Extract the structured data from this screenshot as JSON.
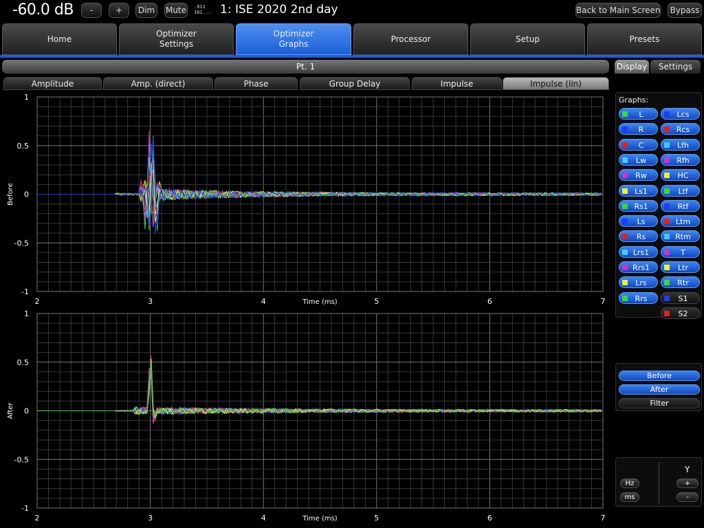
{
  "topbar": {
    "volume": "-60.0 dB",
    "minus_label": "-",
    "plus_label": "+",
    "dim_label": "Dim",
    "mute_label": "Mute",
    "tiny_line1": ".011",
    "tiny_line2": "101...",
    "preset_title": "1: ISE 2020 2nd day",
    "back_label": "Back to Main Screen",
    "bypass_label": "Bypass"
  },
  "main_tabs": [
    {
      "label": "Home",
      "active": false
    },
    {
      "label": "Optimizer\nSettings",
      "active": false
    },
    {
      "label": "Optimizer\nGraphs",
      "active": true
    },
    {
      "label": "Processor",
      "active": false
    },
    {
      "label": "Setup",
      "active": false
    },
    {
      "label": "Presets",
      "active": false
    }
  ],
  "point_header": "Pt. 1",
  "graph_tabs": [
    {
      "label": "Amplitude",
      "active": false
    },
    {
      "label": "Amp. (direct)",
      "active": false
    },
    {
      "label": "Phase",
      "active": false
    },
    {
      "label": "Group Delay",
      "active": false
    },
    {
      "label": "Impulse",
      "active": false
    },
    {
      "label": "Impulse (lin)",
      "active": true
    }
  ],
  "side_tabs": {
    "display": "Display",
    "settings": "Settings"
  },
  "graphs_label": "Graphs:",
  "channels_left": [
    {
      "label": "L",
      "color": "#33dd33",
      "active": true
    },
    {
      "label": "R",
      "color": "#1a3fff",
      "active": true
    },
    {
      "label": "C",
      "color": "#dd2222",
      "active": true
    },
    {
      "label": "Lw",
      "color": "#44ccff",
      "active": true
    },
    {
      "label": "Rw",
      "color": "#cc33cc",
      "active": true
    },
    {
      "label": "Ls1",
      "color": "#eeee33",
      "active": true
    },
    {
      "label": "Rs1",
      "color": "#33dd33",
      "active": true
    },
    {
      "label": "Ls",
      "color": "#1a3fff",
      "active": true
    },
    {
      "label": "Rs",
      "color": "#dd2222",
      "active": true
    },
    {
      "label": "Lrs1",
      "color": "#44ccff",
      "active": true
    },
    {
      "label": "Rrs1",
      "color": "#cc33cc",
      "active": true
    },
    {
      "label": "Lrs",
      "color": "#eeee33",
      "active": true
    },
    {
      "label": "Rrs",
      "color": "#33dd33",
      "active": true
    }
  ],
  "channels_right": [
    {
      "label": "Lcs",
      "color": "#1a3fff",
      "active": true
    },
    {
      "label": "Rcs",
      "color": "#dd2222",
      "active": true
    },
    {
      "label": "Lfh",
      "color": "#44ccff",
      "active": true
    },
    {
      "label": "Rfh",
      "color": "#cc33cc",
      "active": true
    },
    {
      "label": "HC",
      "color": "#eeee33",
      "active": true
    },
    {
      "label": "Ltf",
      "color": "#33dd33",
      "active": true
    },
    {
      "label": "Rtf",
      "color": "#1a3fff",
      "active": true
    },
    {
      "label": "Ltm",
      "color": "#dd2222",
      "active": true
    },
    {
      "label": "Rtm",
      "color": "#44ccff",
      "active": true
    },
    {
      "label": "T",
      "color": "#cc33cc",
      "active": true
    },
    {
      "label": "Ltr",
      "color": "#eeee33",
      "active": true
    },
    {
      "label": "Rtr",
      "color": "#33dd33",
      "active": true
    },
    {
      "label": "S1",
      "color": "#1a3fff",
      "active": false
    },
    {
      "label": "S2",
      "color": "#dd2222",
      "active": false
    }
  ],
  "view_toggles": [
    {
      "label": "Before",
      "active": true
    },
    {
      "label": "After",
      "active": true
    },
    {
      "label": "Filter",
      "active": false
    }
  ],
  "zoom": {
    "hz_label": "Hz",
    "ms_label": "ms",
    "y_label": "Y",
    "y_plus": "+",
    "y_minus": "-"
  },
  "chart_data": [
    {
      "type": "line",
      "ylabel": "Before",
      "xlabel": "Time (ms)",
      "xlim": [
        2,
        7
      ],
      "ylim": [
        -1,
        1
      ],
      "x_ticks": [
        "2",
        "3",
        "4",
        "5",
        "6",
        "7"
      ],
      "y_ticks": [
        "1",
        "0.5",
        "0",
        "-0.5",
        "-1"
      ],
      "grid": true,
      "peak_time_ms": 3.0,
      "peak_max": 0.62,
      "peak_min": -0.47,
      "series_colors": [
        "#33dd33",
        "#1a3fff",
        "#dd2222",
        "#44ccff",
        "#cc33cc",
        "#eeee33"
      ]
    },
    {
      "type": "line",
      "ylabel": "After",
      "xlabel": "Time (ms)",
      "xlim": [
        2,
        7
      ],
      "ylim": [
        -1,
        1
      ],
      "x_ticks": [
        "2",
        "3",
        "4",
        "5",
        "6",
        "7"
      ],
      "y_ticks": [
        "1",
        "0.5",
        "0",
        "-0.5",
        "-1"
      ],
      "grid": true,
      "peak_time_ms": 3.0,
      "peak_max": 0.62,
      "peak_min": -0.14,
      "series_colors": [
        "#33dd33",
        "#1a3fff",
        "#dd2222",
        "#44ccff",
        "#cc33cc",
        "#eeee33"
      ]
    }
  ]
}
